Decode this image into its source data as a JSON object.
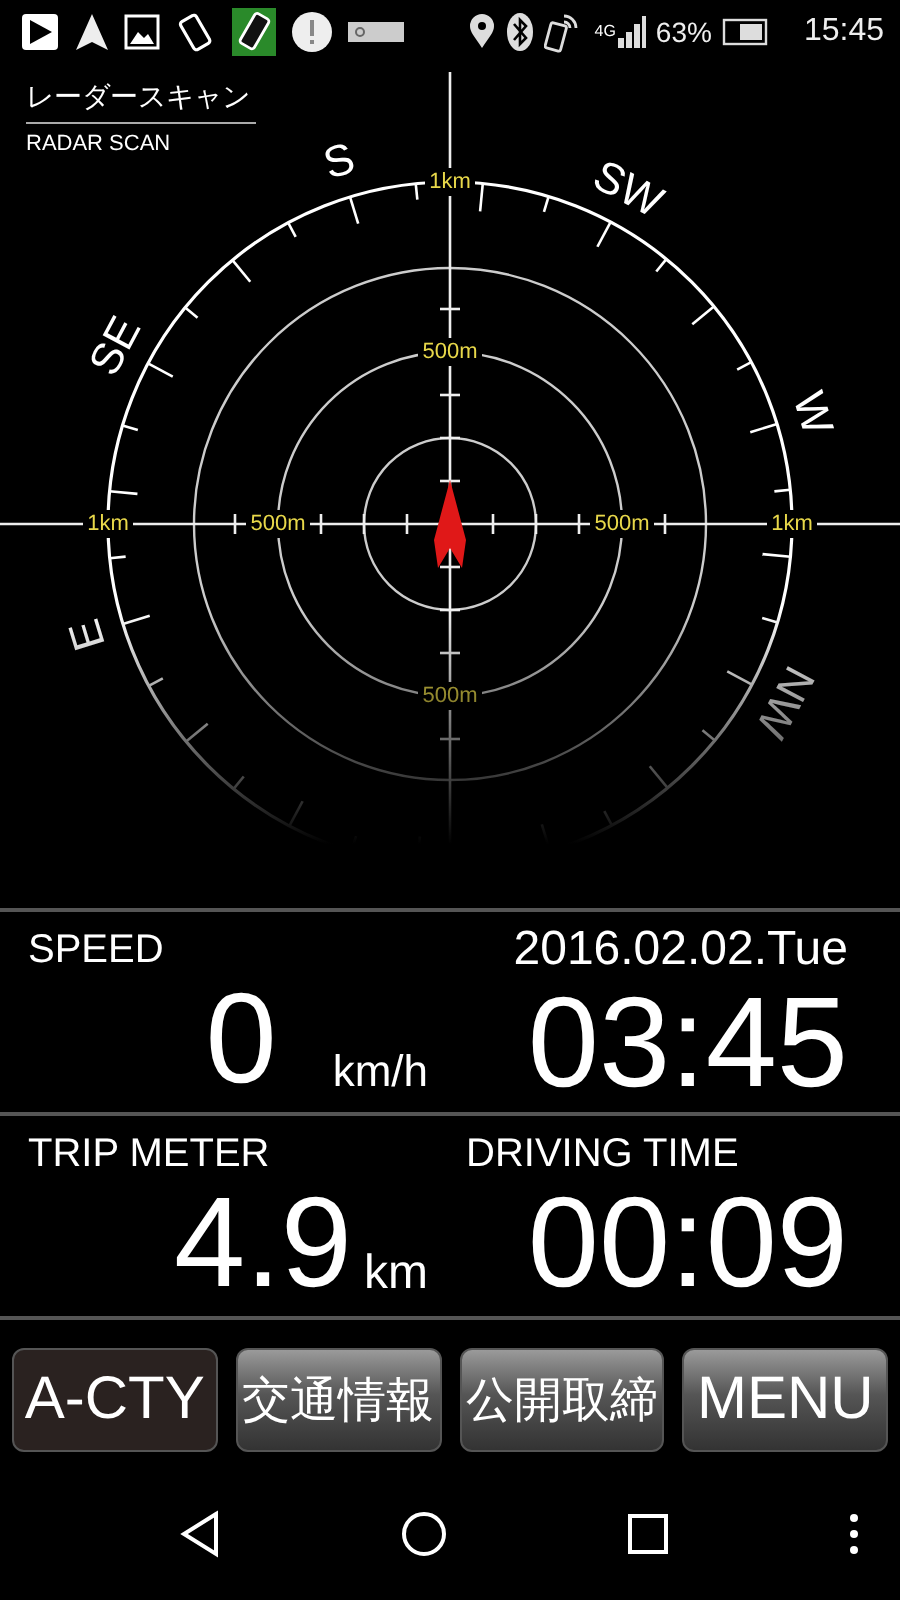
{
  "status_bar": {
    "network": "4G",
    "battery": "63%",
    "time": "15:45"
  },
  "radar": {
    "title": "レーダースキャン",
    "subtitle": "RADAR SCAN",
    "compass_labels": [
      "S",
      "SW",
      "W",
      "NW",
      "E",
      "SE"
    ],
    "range_labels": [
      "1km",
      "500m",
      "500m",
      "1km",
      "500m",
      "500m",
      "1km"
    ]
  },
  "speed": {
    "label": "SPEED",
    "value": "0",
    "unit": "km/h"
  },
  "clock": {
    "date": "2016.02.02.Tue",
    "time": "03:45"
  },
  "trip": {
    "label": "TRIP METER",
    "value": "4.9",
    "unit": "km"
  },
  "driving_time": {
    "label": "DRIVING TIME",
    "value": "00:09"
  },
  "buttons": [
    {
      "label": "A-CTY",
      "selected": true
    },
    {
      "label": "交通情報",
      "selected": false
    },
    {
      "label": "公開取締",
      "selected": false
    },
    {
      "label": "MENU",
      "selected": false
    }
  ]
}
